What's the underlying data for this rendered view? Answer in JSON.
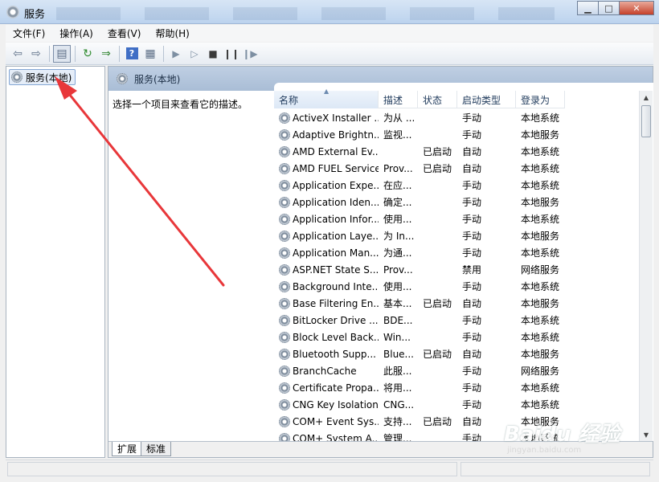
{
  "window": {
    "title": "服务",
    "minimize": "▁",
    "maximize": "□",
    "close": "✕"
  },
  "menu": [
    "文件(F)",
    "操作(A)",
    "查看(V)",
    "帮助(H)"
  ],
  "toolbar": {
    "icons": [
      "back-arrow-icon",
      "forward-arrow-icon",
      "show-hide-tree-icon",
      "refresh-icon",
      "export-list-icon",
      "help-icon",
      "properties-icon",
      "start-service-icon",
      "start-service-alt-icon",
      "stop-service-icon",
      "pause-service-icon",
      "restart-service-icon"
    ],
    "help_glyph": "?"
  },
  "tree": {
    "root_label": "服务(本地)"
  },
  "pane": {
    "header": "服务(本地)",
    "description_hint": "选择一个项目来查看它的描述。"
  },
  "columns": [
    "名称",
    "描述",
    "状态",
    "启动类型",
    "登录为"
  ],
  "services": [
    {
      "name": "ActiveX Installer ...",
      "desc": "为从 ...",
      "status": "",
      "startup": "手动",
      "logon": "本地系统"
    },
    {
      "name": "Adaptive Brightn...",
      "desc": "监视...",
      "status": "",
      "startup": "手动",
      "logon": "本地服务"
    },
    {
      "name": "AMD External Ev...",
      "desc": "",
      "status": "已启动",
      "startup": "自动",
      "logon": "本地系统"
    },
    {
      "name": "AMD FUEL Service",
      "desc": "Prov...",
      "status": "已启动",
      "startup": "自动",
      "logon": "本地系统"
    },
    {
      "name": "Application Expe...",
      "desc": "在应...",
      "status": "",
      "startup": "手动",
      "logon": "本地系统"
    },
    {
      "name": "Application Iden...",
      "desc": "确定...",
      "status": "",
      "startup": "手动",
      "logon": "本地服务"
    },
    {
      "name": "Application Infor...",
      "desc": "使用...",
      "status": "",
      "startup": "手动",
      "logon": "本地系统"
    },
    {
      "name": "Application Laye...",
      "desc": "为 In...",
      "status": "",
      "startup": "手动",
      "logon": "本地服务"
    },
    {
      "name": "Application Man...",
      "desc": "为通...",
      "status": "",
      "startup": "手动",
      "logon": "本地系统"
    },
    {
      "name": "ASP.NET State S...",
      "desc": "Prov...",
      "status": "",
      "startup": "禁用",
      "logon": "网络服务"
    },
    {
      "name": "Background Inte...",
      "desc": "使用...",
      "status": "",
      "startup": "手动",
      "logon": "本地系统"
    },
    {
      "name": "Base Filtering En...",
      "desc": "基本...",
      "status": "已启动",
      "startup": "自动",
      "logon": "本地服务"
    },
    {
      "name": "BitLocker Drive ...",
      "desc": "BDE...",
      "status": "",
      "startup": "手动",
      "logon": "本地系统"
    },
    {
      "name": "Block Level Back...",
      "desc": "Win...",
      "status": "",
      "startup": "手动",
      "logon": "本地系统"
    },
    {
      "name": "Bluetooth Supp...",
      "desc": "Blue...",
      "status": "已启动",
      "startup": "自动",
      "logon": "本地服务"
    },
    {
      "name": "BranchCache",
      "desc": "此服...",
      "status": "",
      "startup": "手动",
      "logon": "网络服务"
    },
    {
      "name": "Certificate Propa...",
      "desc": "将用...",
      "status": "",
      "startup": "手动",
      "logon": "本地系统"
    },
    {
      "name": "CNG Key Isolation",
      "desc": "CNG...",
      "status": "",
      "startup": "手动",
      "logon": "本地系统"
    },
    {
      "name": "COM+ Event Sys...",
      "desc": "支持...",
      "status": "已启动",
      "startup": "自动",
      "logon": "本地服务"
    },
    {
      "name": "COM+ System A...",
      "desc": "管理...",
      "status": "",
      "startup": "手动",
      "logon": "本地系统"
    }
  ],
  "tabs": [
    "扩展",
    "标准"
  ],
  "watermark": {
    "logo": "Baidu 经验",
    "sub": "jingyan.baidu.com"
  },
  "colors": {
    "header_blue": "#a9bdd6",
    "selection_border": "#84a6d4",
    "arrow_red": "#e8373a"
  }
}
